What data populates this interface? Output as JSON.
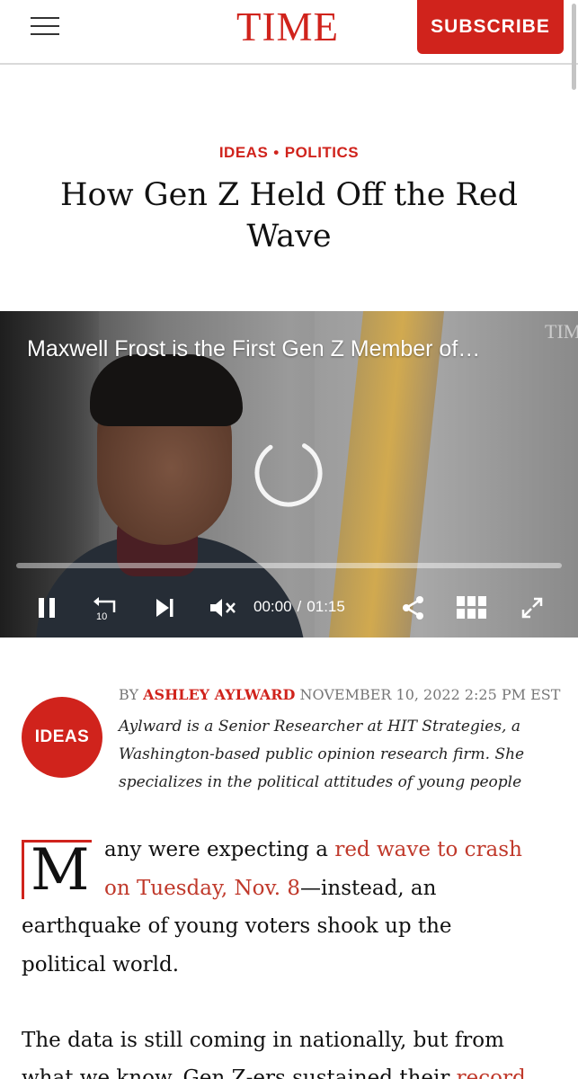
{
  "header": {
    "menu_icon": "hamburger-menu-icon",
    "logo": "TIME",
    "subscribe_label": "SUBSCRIBE"
  },
  "article": {
    "kicker": {
      "section1": "IDEAS",
      "separator": "•",
      "section2": "POLITICS"
    },
    "title": "How Gen Z Held Off the Red Wave"
  },
  "video": {
    "title": "Maxwell Frost is the First Gen Z Member of…",
    "watermark": "TIM",
    "current_time": "00:00",
    "time_separator": "/",
    "duration": "01:15",
    "progress": 0,
    "controls": [
      "pause-icon",
      "replay-10-icon",
      "skip-next-icon",
      "mute-icon",
      "share-icon",
      "grid-icon",
      "fullscreen-icon"
    ]
  },
  "byline": {
    "badge": "IDEAS",
    "by": "BY",
    "author": "ASHLEY AYLWARD",
    "date": "NOVEMBER 10, 2022 2:25 PM EST",
    "bio_lines": [
      "Aylward is a Senior Researcher at HIT Strategies, a",
      "Washington-based public opinion research firm. She",
      "specializes in the political attitudes of young people"
    ]
  },
  "body": {
    "dropcap": "M",
    "p1": {
      "l1_text": "any were expecting a ",
      "l1_link": "red wave to crash",
      "l2_link": "on Tuesday, Nov. 8",
      "l2_text": "—instead, an",
      "l3": "earthquake of young voters shook up the",
      "l4": "political world."
    },
    "p2": {
      "l1": "The data is still coming in nationally, but from",
      "l2_text": "what we know, Gen Z-ers sustained their ",
      "l2_link": "record"
    }
  },
  "colors": {
    "accent": "#d0231c",
    "link": "#c0392b"
  }
}
